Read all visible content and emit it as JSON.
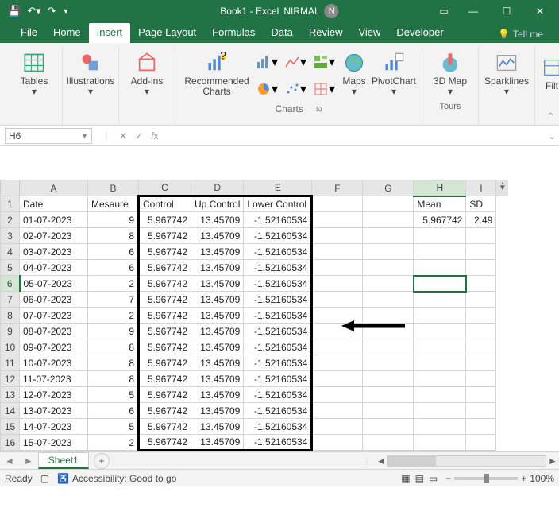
{
  "titlebar": {
    "title": "Book1 - Excel",
    "user": "NIRMAL",
    "user_initial": "N"
  },
  "tabs": {
    "file": "File",
    "home": "Home",
    "insert": "Insert",
    "page_layout": "Page Layout",
    "formulas": "Formulas",
    "data": "Data",
    "review": "Review",
    "view": "View",
    "developer": "Developer",
    "tellme": "Tell me"
  },
  "ribbon": {
    "tables": "Tables",
    "illustrations": "Illustrations",
    "addins": "Add-ins",
    "recommended_charts": "Recommended Charts",
    "charts_group": "Charts",
    "maps": "Maps",
    "pivotchart": "PivotChart",
    "tours_group": "Tours",
    "map3d": "3D Map",
    "sparklines": "Sparklines",
    "filters": "Filt"
  },
  "namebox": "H6",
  "columns": [
    "A",
    "B",
    "C",
    "D",
    "E",
    "F",
    "G",
    "H",
    "I"
  ],
  "headers": {
    "A": "Date",
    "B": "Mesaure",
    "C": "Control",
    "D": "Up Control",
    "E": "Lower Control",
    "H": "Mean",
    "I": "SD"
  },
  "row2": {
    "H": "5.967742",
    "I": "2.49"
  },
  "rows": [
    {
      "n": 2,
      "A": "01-07-2023",
      "B": "9",
      "C": "5.967742",
      "D": "13.45709",
      "E": "-1.52160534"
    },
    {
      "n": 3,
      "A": "02-07-2023",
      "B": "8",
      "C": "5.967742",
      "D": "13.45709",
      "E": "-1.52160534"
    },
    {
      "n": 4,
      "A": "03-07-2023",
      "B": "6",
      "C": "5.967742",
      "D": "13.45709",
      "E": "-1.52160534"
    },
    {
      "n": 5,
      "A": "04-07-2023",
      "B": "6",
      "C": "5.967742",
      "D": "13.45709",
      "E": "-1.52160534"
    },
    {
      "n": 6,
      "A": "05-07-2023",
      "B": "2",
      "C": "5.967742",
      "D": "13.45709",
      "E": "-1.52160534"
    },
    {
      "n": 7,
      "A": "06-07-2023",
      "B": "7",
      "C": "5.967742",
      "D": "13.45709",
      "E": "-1.52160534"
    },
    {
      "n": 8,
      "A": "07-07-2023",
      "B": "2",
      "C": "5.967742",
      "D": "13.45709",
      "E": "-1.52160534"
    },
    {
      "n": 9,
      "A": "08-07-2023",
      "B": "9",
      "C": "5.967742",
      "D": "13.45709",
      "E": "-1.52160534"
    },
    {
      "n": 10,
      "A": "09-07-2023",
      "B": "8",
      "C": "5.967742",
      "D": "13.45709",
      "E": "-1.52160534"
    },
    {
      "n": 11,
      "A": "10-07-2023",
      "B": "8",
      "C": "5.967742",
      "D": "13.45709",
      "E": "-1.52160534"
    },
    {
      "n": 12,
      "A": "11-07-2023",
      "B": "8",
      "C": "5.967742",
      "D": "13.45709",
      "E": "-1.52160534"
    },
    {
      "n": 13,
      "A": "12-07-2023",
      "B": "5",
      "C": "5.967742",
      "D": "13.45709",
      "E": "-1.52160534"
    },
    {
      "n": 14,
      "A": "13-07-2023",
      "B": "6",
      "C": "5.967742",
      "D": "13.45709",
      "E": "-1.52160534"
    },
    {
      "n": 15,
      "A": "14-07-2023",
      "B": "5",
      "C": "5.967742",
      "D": "13.45709",
      "E": "-1.52160534"
    },
    {
      "n": 16,
      "A": "15-07-2023",
      "B": "2",
      "C": "5.967742",
      "D": "13.45709",
      "E": "-1.52160534"
    }
  ],
  "sheet_tab": "Sheet1",
  "status": {
    "ready": "Ready",
    "acc": "Accessibility: Good to go",
    "zoom": "100%"
  }
}
